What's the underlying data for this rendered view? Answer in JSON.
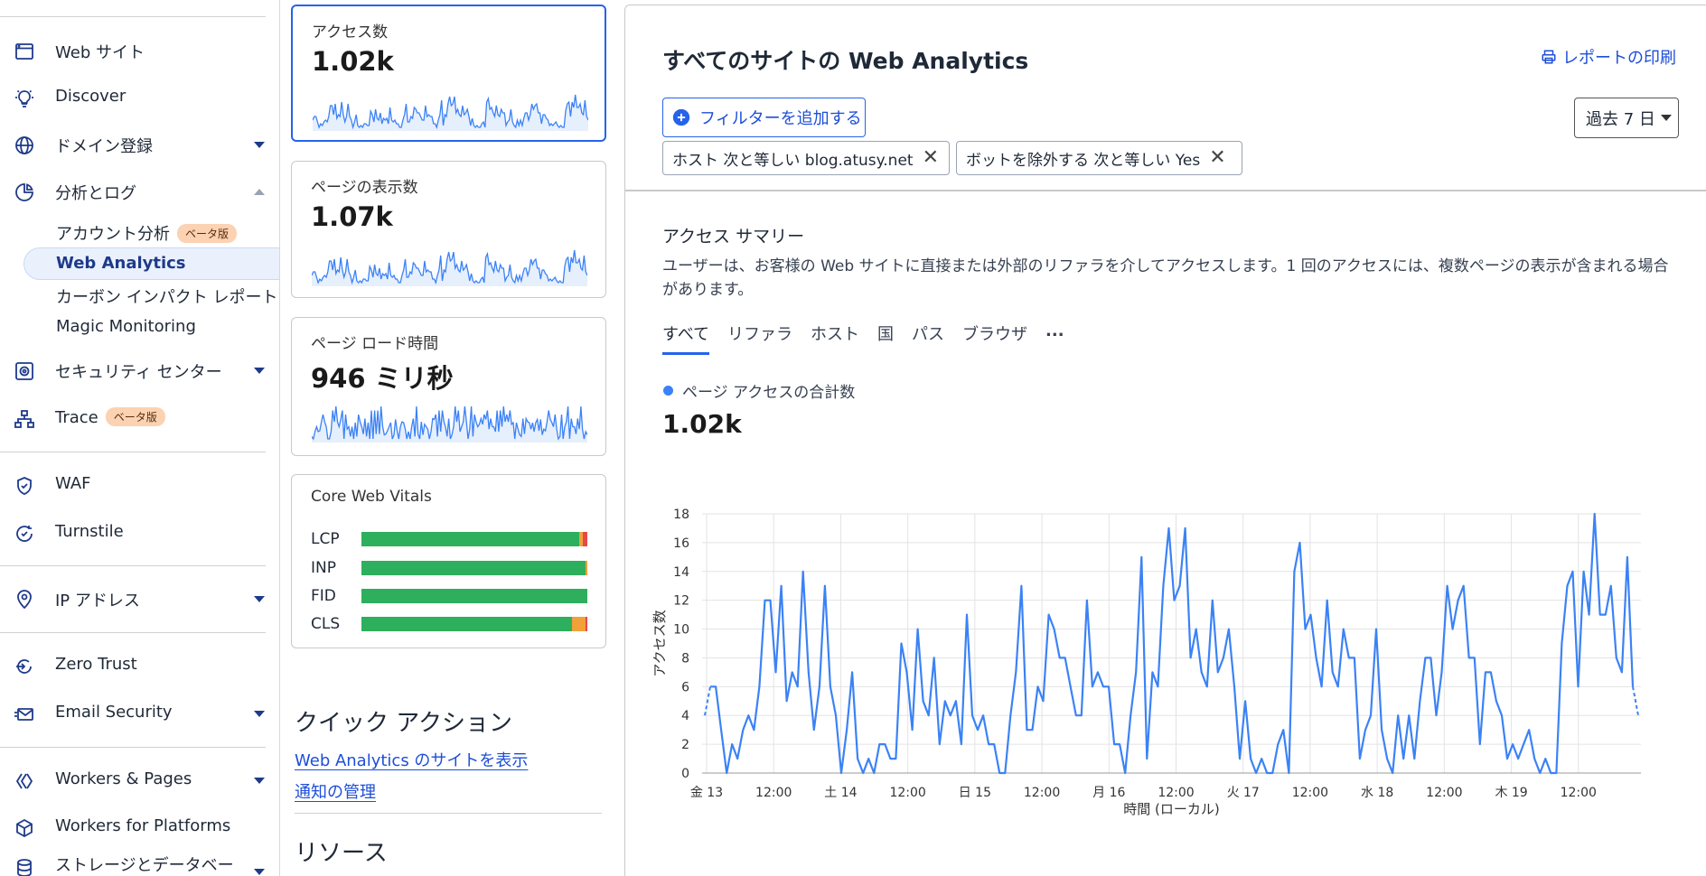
{
  "sidebar": {
    "items": [
      {
        "icon": "browser-window-icon",
        "label": "Web サイト"
      },
      {
        "icon": "lightbulb-icon",
        "label": "Discover"
      },
      {
        "icon": "globe-icon",
        "label": "ドメイン登録"
      },
      {
        "icon": "pie-chart-icon",
        "label": "分析とログ"
      },
      {
        "icon": "security-center-icon",
        "label": "セキュリティ センター"
      },
      {
        "icon": "network-tree-icon",
        "label": "Trace"
      },
      {
        "icon": "shield-icon",
        "label": "WAF"
      },
      {
        "icon": "refresh-check-icon",
        "label": "Turnstile"
      },
      {
        "icon": "location-pin-icon",
        "label": "IP アドレス"
      },
      {
        "icon": "zero-trust-icon",
        "label": "Zero Trust"
      },
      {
        "icon": "envelope-icon",
        "label": "Email Security"
      },
      {
        "icon": "workers-icon",
        "label": "Workers & Pages"
      },
      {
        "icon": "cube-icon",
        "label": "Workers for Platforms"
      },
      {
        "icon": "database-icon",
        "label": "ストレージとデータベー"
      }
    ],
    "sub_items": [
      "アカウント分析",
      "Web Analytics",
      "カーボン インパクト レポート",
      "Magic Monitoring"
    ],
    "beta_badge": "ベータ版"
  },
  "metrics": [
    {
      "label": "アクセス数",
      "value": "1.02k"
    },
    {
      "label": "ページの表示数",
      "value": "1.07k"
    },
    {
      "label": "ページ ロード時間",
      "value": "946 ミリ秒"
    }
  ],
  "core_web_vitals": {
    "title": "Core Web Vitals",
    "rows": [
      {
        "name": "LCP",
        "good": 0.962,
        "needs_improvement": 0.019,
        "poor": 0.019
      },
      {
        "name": "INP",
        "good": 0.99,
        "needs_improvement": 0.01,
        "poor": 0.0
      },
      {
        "name": "FID",
        "good": 1.0,
        "needs_improvement": 0.0,
        "poor": 0.0
      },
      {
        "name": "CLS",
        "good": 0.93,
        "needs_improvement": 0.06,
        "poor": 0.01
      }
    ],
    "colors": {
      "good": "#2eaf5d",
      "needs_improvement": "#f0a13a",
      "poor": "#e5484d"
    }
  },
  "quick_actions": {
    "title": "クイック アクション",
    "links": [
      "Web Analytics のサイトを表示",
      "通知の管理"
    ]
  },
  "resources_title": "リソース",
  "main": {
    "title": "すべてのサイトの Web Analytics",
    "print_label": "レポートの印刷",
    "filter_button": "フィルターを追加する",
    "date_range": "過去 7 日",
    "filters": [
      "ホスト 次と等しい blog.atusy.net",
      "ボットを除外する 次と等しい Yes"
    ],
    "summary_title": "アクセス サマリー",
    "summary_desc": "ユーザーは、お客様の Web サイトに直接または外部のリファラを介してアクセスします。1 回のアクセスには、複数ページの表示が含まれる場合があります。",
    "tabs": [
      "すべて",
      "リファラ",
      "ホスト",
      "国",
      "パス",
      "ブラウザ",
      "..."
    ],
    "legend": "ページ アクセスの合計数",
    "total": "1.02k"
  },
  "chart_data": {
    "type": "line",
    "title": "",
    "xlabel": "時間 (ローカル)",
    "ylabel": "アクセス数",
    "ylim": [
      0,
      18
    ],
    "yticks": [
      0,
      2,
      4,
      6,
      8,
      10,
      12,
      14,
      16,
      18
    ],
    "xticks": [
      "金 13",
      "12:00",
      "土 14",
      "12:00",
      "日 15",
      "12:00",
      "月 16",
      "12:00",
      "火 17",
      "12:00",
      "水 18",
      "12:00",
      "木 19",
      "12:00"
    ],
    "grid": true,
    "color": "#3b82f6",
    "series": [
      {
        "values": [
          4,
          6,
          6,
          3,
          0,
          2,
          1,
          3,
          4,
          3,
          6,
          12,
          12,
          7,
          13,
          5,
          7,
          6,
          14,
          7,
          3,
          6,
          13,
          6,
          4,
          0,
          3,
          7,
          1,
          0,
          1,
          0,
          2,
          2,
          1,
          1,
          9,
          7,
          3,
          10,
          5,
          4,
          8,
          2,
          5,
          4,
          5,
          2,
          11,
          4,
          3,
          4,
          2,
          2,
          0,
          0,
          4,
          7,
          13,
          3,
          3,
          6,
          5,
          11,
          10,
          8,
          8,
          6,
          4,
          4,
          12,
          6,
          7,
          6,
          6,
          2,
          2,
          0,
          4,
          7,
          15,
          1,
          7,
          6,
          13,
          17,
          12,
          13,
          17,
          8,
          10,
          7,
          6,
          12,
          7,
          8,
          10,
          6,
          1,
          5,
          1,
          0,
          1,
          0,
          0,
          2,
          3,
          0,
          14,
          16,
          10,
          11,
          8,
          6,
          12,
          7,
          6,
          10,
          8,
          8,
          1,
          3,
          4,
          10,
          3,
          1,
          0,
          4,
          1,
          4,
          1,
          5,
          8,
          8,
          4,
          7,
          13,
          10,
          12,
          13,
          8,
          8,
          2,
          7,
          7,
          5,
          4,
          1,
          2,
          1,
          2,
          3,
          1,
          0,
          1,
          0,
          0,
          9,
          13,
          14,
          6,
          14,
          11,
          18,
          11,
          11,
          13,
          8,
          7,
          15,
          6,
          4
        ]
      }
    ]
  }
}
